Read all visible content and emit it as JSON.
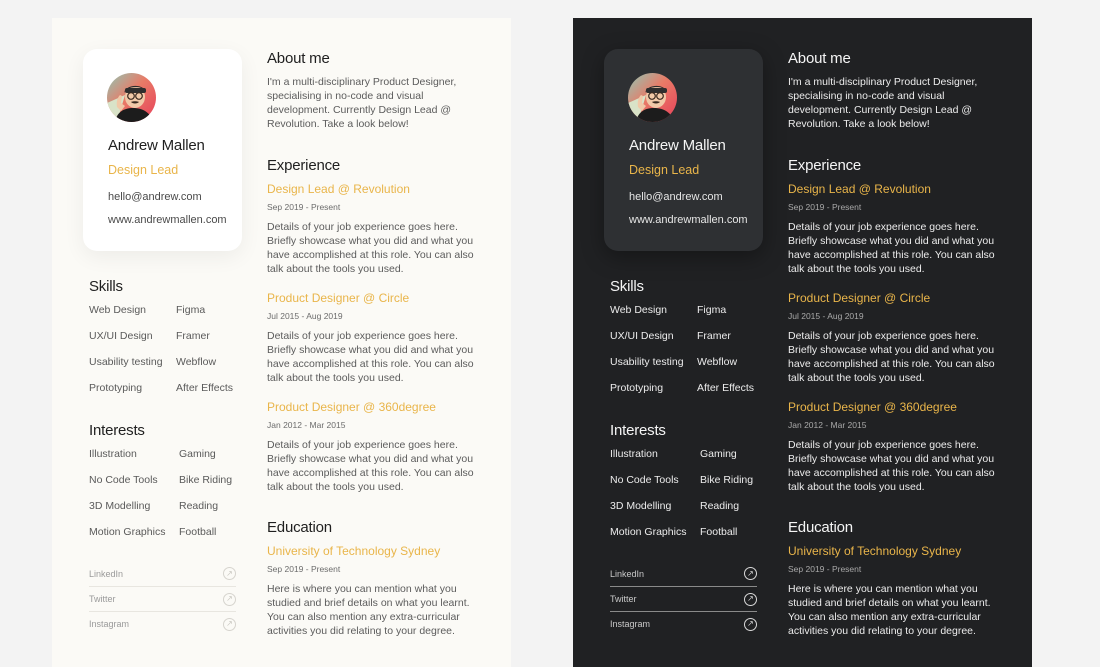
{
  "accent_color": "#e9b54a",
  "themes": [
    {
      "id": "light",
      "label": "Light theme"
    },
    {
      "id": "dark",
      "label": "Dark theme"
    }
  ],
  "profile": {
    "avatar_icon": "avatar-memoji",
    "name": "Andrew Mallen",
    "role": "Design Lead",
    "email": "hello@andrew.com",
    "website": "www.andrewmallen.com"
  },
  "skills": {
    "title": "Skills",
    "items": [
      "Web Design",
      "Figma",
      "UX/UI Design",
      "Framer",
      "Usability testing",
      "Webflow",
      "Prototyping",
      "After Effects"
    ]
  },
  "interests": {
    "title": "Interests",
    "items": [
      "Illustration",
      "Gaming",
      "No Code Tools",
      "Bike Riding",
      "3D Modelling",
      "Reading",
      "Motion Graphics",
      "Football"
    ]
  },
  "socials": [
    {
      "label": "LinkedIn",
      "icon": "arrow-up-right-circle-icon"
    },
    {
      "label": "Twitter",
      "icon": "arrow-up-right-circle-icon"
    },
    {
      "label": "Instagram",
      "icon": "arrow-up-right-circle-icon"
    }
  ],
  "about": {
    "title": "About me",
    "text": "I'm a multi-disciplinary Product Designer, specialising in no-code and visual development. Currently Design Lead @ Revolution. Take a look below!"
  },
  "experience": {
    "title": "Experience",
    "items": [
      {
        "title": "Design Lead @ Revolution",
        "dates": "Sep 2019  -  Present",
        "text": "Details of your job experience goes here. Briefly showcase what you did and what you have accomplished at this role. You can also talk about the tools you used."
      },
      {
        "title": "Product Designer @ Circle",
        "dates": "Jul 2015  -  Aug 2019",
        "text": "Details of your job experience goes here. Briefly showcase what you did and what you have accomplished at this role. You can also talk about the tools you used."
      },
      {
        "title": "Product Designer @ 360degree",
        "dates": "Jan 2012  -  Mar 2015",
        "text": "Details of your job experience goes here. Briefly showcase what you did and what you have accomplished at this role. You can also talk about the tools you used."
      }
    ]
  },
  "education": {
    "title": "Education",
    "school": "University of Technology Sydney",
    "dates": "Sep 2019  -  Present",
    "text": "Here is where you can mention what you studied and brief details on what you learnt. You can also mention any extra-curricular activities you did relating to your degree."
  }
}
